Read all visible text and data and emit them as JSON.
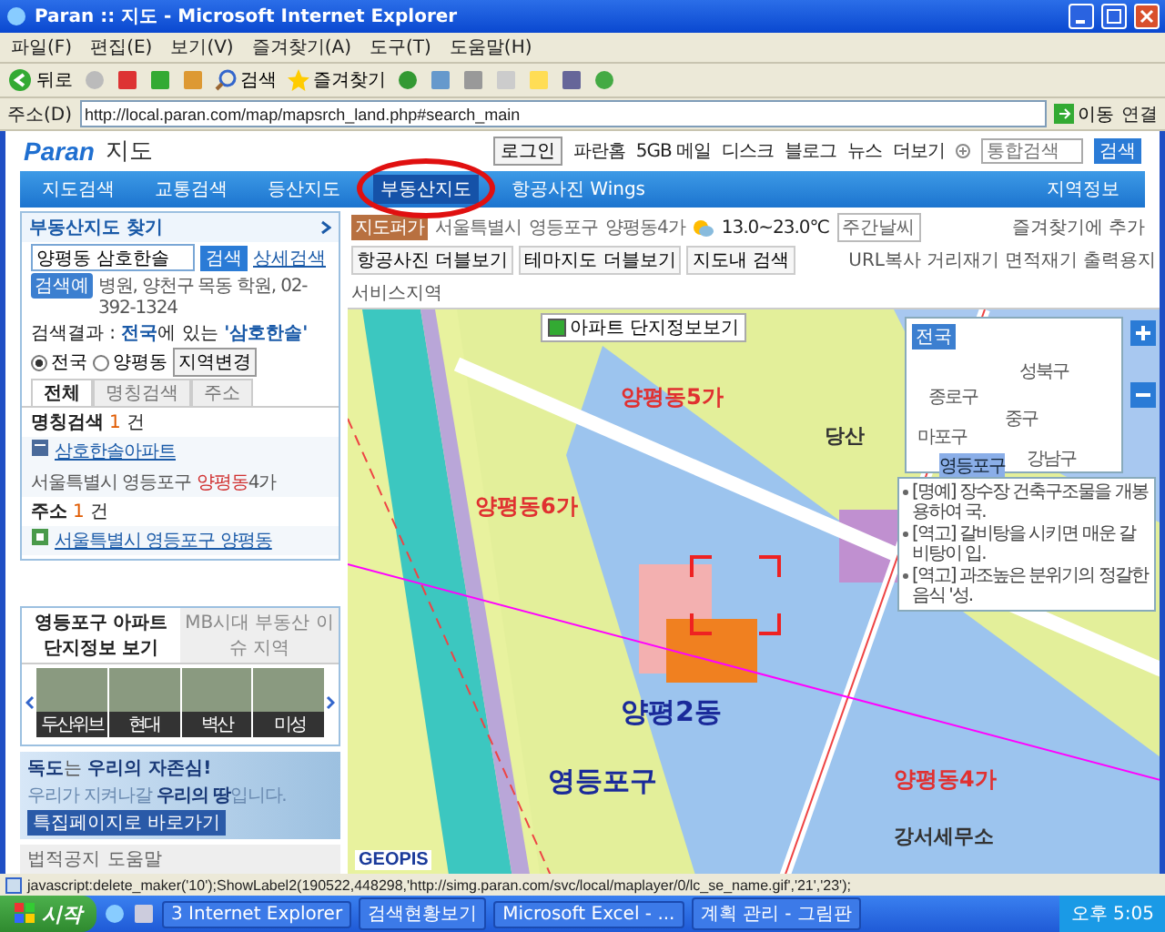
{
  "window": {
    "title": "Paran :: 지도 - Microsoft Internet Explorer"
  },
  "menu": [
    "파일(F)",
    "편집(E)",
    "보기(V)",
    "즐겨찾기(A)",
    "도구(T)",
    "도움말(H)"
  ],
  "toolbar": {
    "back": "뒤로",
    "search": "검색",
    "favorites": "즐겨찾기"
  },
  "address_bar": {
    "label": "주소(D)",
    "url": "http://local.paran.com/map/mapsrch_land.php#search_main",
    "go": "이동",
    "links": "연결"
  },
  "site": {
    "logo_brand": "Paran",
    "logo_service": "지도",
    "login": "로그인",
    "top_links": [
      "파란홈",
      "5GB 메일",
      "디스크",
      "블로그",
      "뉴스"
    ],
    "more": "더보기",
    "search_placeholder": "통합검색",
    "search_button": "검색"
  },
  "nav": {
    "items": [
      {
        "label": "지도검색",
        "selected": false
      },
      {
        "label": "교통검색",
        "selected": false
      },
      {
        "label": "등산지도",
        "selected": false
      },
      {
        "label": "부동산지도",
        "selected": true
      },
      {
        "label": "항공사진 Wings",
        "selected": false
      }
    ],
    "region_link": "지역정보"
  },
  "left_panel": {
    "title": "부동산지도 찾기",
    "query": "양평동 삼호한솔",
    "search_button": "검색",
    "detail_link": "상세검색",
    "example_tag": "검색예",
    "example_text": "병원, 양천구 목동 학원, 02-392-1324",
    "result_summary": "검색결과 : **전국**에 있는 **'삼호한솔'**",
    "scope_options": [
      {
        "label": "전국",
        "selected": true
      },
      {
        "label": "양평동",
        "selected": false
      }
    ],
    "region_button": "지역변경",
    "tabs": [
      {
        "label": "전체",
        "selected": true
      },
      {
        "label": "명칭검색",
        "selected": false
      },
      {
        "label": "주소",
        "selected": false
      }
    ],
    "groups": [
      {
        "title": "명칭검색",
        "count": "1",
        "unit": "건",
        "results": [
          {
            "kind": "place",
            "name": "삼호한솔아파트",
            "address": "서울특별시 영등포구 **양평동**4가"
          }
        ]
      },
      {
        "title": "주소",
        "count": "1",
        "unit": "건",
        "results": [
          {
            "kind": "address",
            "address": "서울특별시 영등포구 양평동"
          }
        ]
      }
    ],
    "apartment_tabs": [
      {
        "label": "영등포구 아파트 단지정보 보기",
        "selected": true
      },
      {
        "label": "MB시대 부동산 이슈 지역",
        "selected": false
      }
    ],
    "photos": [
      "두산위브",
      "현대",
      "벽산",
      "미성"
    ],
    "banner": {
      "headline": "**독도**는 **우리의 자존심!**",
      "line": "우리가 지켜나갈 **우리의 땅**입니다.",
      "button": "특집페이지로 바로가기"
    },
    "footer_links": [
      "법적공지",
      "도움말"
    ]
  },
  "map": {
    "badge": "지도퍼가",
    "breadcrumb": [
      "서울특별시",
      "영등포구",
      "양평동4가"
    ],
    "temperature": "13.0~23.0℃",
    "weekly_weather": "주간날씨",
    "add_favorite": "즐겨찾기에 추가",
    "view_buttons": [
      "항공사진 더블보기",
      "테마지도 더블보기",
      "지도내 검색"
    ],
    "tools": [
      "URL복사",
      "거리재기",
      "면적재기",
      "출력용지",
      "서비스지역"
    ],
    "apartment_info": {
      "label": "아파트 단지정보보기",
      "checked": true
    },
    "labels": [
      {
        "text": "양평동6가",
        "kind": "dong"
      },
      {
        "text": "양평동5가",
        "kind": "dong"
      },
      {
        "text": "영등포구",
        "kind": "district"
      },
      {
        "text": "양평2동",
        "kind": "district"
      },
      {
        "text": "양평동4가",
        "kind": "dong"
      },
      {
        "text": "당산",
        "kind": "area"
      },
      {
        "text": "강서세무소",
        "kind": "area"
      }
    ],
    "minimap": {
      "button": "전국",
      "districts": [
        {
          "name": "성북구",
          "selected": false
        },
        {
          "name": "종로구",
          "selected": false
        },
        {
          "name": "마포구",
          "selected": false
        },
        {
          "name": "중구",
          "selected": false
        },
        {
          "name": "영등포구",
          "selected": true
        },
        {
          "name": "강남구",
          "selected": false
        }
      ]
    },
    "notices": [
      "[명예] 장수장 건축구조물을 개봉용하여 국.",
      "[역고] 갈비탕을 시키면 매운 갈비탕이 입.",
      "[역고] 과조높은 분위기의 정갈한 음식 '성."
    ],
    "provider": "GEOPIS"
  },
  "status_bar": "javascript:delete_maker('10');ShowLabel2(190522,448298,'http://simg.paran.com/svc/local/maplayer/0/lc_se_name.gif','21','23');",
  "taskbar": {
    "start": "시작",
    "tasks": [
      "3 Internet Explorer",
      "검색현황보기",
      "Microsoft Excel - ...",
      "계획 관리 - 그림판"
    ],
    "clock": "오후 5:05"
  }
}
